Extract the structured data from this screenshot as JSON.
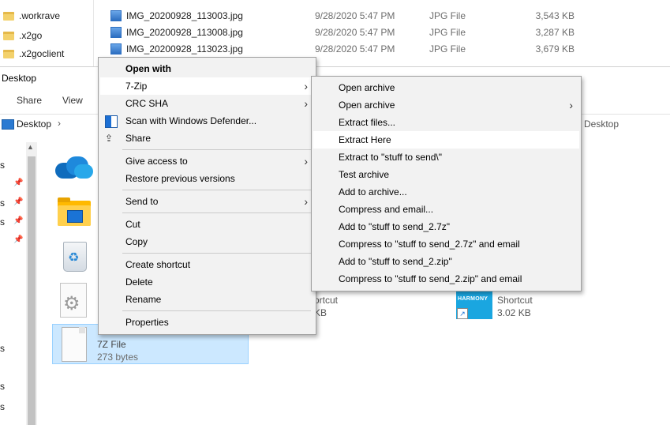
{
  "background_window": {
    "folders": [
      ".workrave",
      ".x2go",
      ".x2goclient"
    ],
    "files": [
      {
        "name": "IMG_20200928_113003.jpg",
        "date": "9/28/2020 5:47 PM",
        "type": "JPG File",
        "size": "3,543 KB"
      },
      {
        "name": "IMG_20200928_113008.jpg",
        "date": "9/28/2020 5:47 PM",
        "type": "JPG File",
        "size": "3,287 KB"
      },
      {
        "name": "IMG_20200928_113023.jpg",
        "date": "9/28/2020 5:47 PM",
        "type": "JPG File",
        "size": "3,679 KB"
      }
    ]
  },
  "desktop_window": {
    "title": "Desktop",
    "ribbon_tabs": [
      "Share",
      "View"
    ],
    "address": "Desktop",
    "address_right": "Desktop",
    "nav_items": [
      "s",
      "s",
      "s",
      "s",
      "s"
    ],
    "selected_file": {
      "type": "7Z File",
      "size": "273 bytes"
    },
    "shortcut1": {
      "name": "ortcut",
      "size": "KB"
    },
    "shortcut2": {
      "name": "Shortcut",
      "size": "3.02 KB",
      "logo": "HARMONY"
    }
  },
  "context_menu": {
    "items": [
      {
        "label": "Open with",
        "bold": true
      },
      {
        "label": "7-Zip",
        "submenu": true,
        "highlight": true
      },
      {
        "label": "CRC SHA",
        "submenu": true
      },
      {
        "label": "Scan with Windows Defender...",
        "icon": "defender-shield-icon"
      },
      {
        "label": "Share",
        "icon": "share-icon"
      },
      {
        "label": "Give access to",
        "submenu": true
      },
      {
        "label": "Restore previous versions"
      },
      {
        "label": "Send to",
        "submenu": true
      },
      {
        "label": "Cut"
      },
      {
        "label": "Copy"
      },
      {
        "label": "Create shortcut"
      },
      {
        "label": "Delete"
      },
      {
        "label": "Rename"
      },
      {
        "label": "Properties"
      }
    ]
  },
  "sevenzip_menu": {
    "items": [
      {
        "label": "Open archive"
      },
      {
        "label": "Open archive",
        "submenu": true
      },
      {
        "label": "Extract files..."
      },
      {
        "label": "Extract Here",
        "highlight": true
      },
      {
        "label": "Extract to \"stuff to send\\\""
      },
      {
        "label": "Test archive"
      },
      {
        "label": "Add to archive..."
      },
      {
        "label": "Compress and email..."
      },
      {
        "label": "Add to \"stuff to send_2.7z\""
      },
      {
        "label": "Compress to \"stuff to send_2.7z\" and email"
      },
      {
        "label": "Add to \"stuff to send_2.zip\""
      },
      {
        "label": "Compress to \"stuff to send_2.zip\" and email"
      }
    ]
  },
  "arrow_glyph": "›",
  "chevron_glyph": "›"
}
